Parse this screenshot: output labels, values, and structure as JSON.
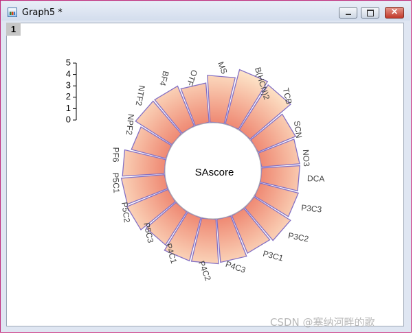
{
  "window": {
    "title": "Graph5 *",
    "layer_label": "1",
    "close_glyph": "✕"
  },
  "watermark": "CSDN @塞纳河畔的歌",
  "chart_data": {
    "type": "radial-bar",
    "center_label": "SAscore",
    "categories": [
      "DCA",
      "P3C3",
      "P3C2",
      "P3C1",
      "P4C3",
      "P4C2",
      "P4C1",
      "P5C3",
      "P5C2",
      "P5C1",
      "PF6",
      "NPF2",
      "NTF2",
      "BF4",
      "OTF",
      "MS",
      "B(HCN)2",
      "TCB",
      "SCN",
      "NO3"
    ],
    "values": [
      3.0,
      3.1,
      3.4,
      3.2,
      3.4,
      3.5,
      3.5,
      3.1,
      3.5,
      3.4,
      3.3,
      2.8,
      3.4,
      3.4,
      3.1,
      3.7,
      4.4,
      4.2,
      3.2,
      3.0
    ],
    "radial_axis": {
      "ticks": [
        "0",
        "1",
        "2",
        "3",
        "4",
        "5"
      ],
      "range": [
        0,
        5
      ]
    },
    "colors": {
      "inner": "#ef8a74",
      "outer": "#fff3d6",
      "edge": "#8470c4",
      "hub_edge": "#b2b2b2"
    },
    "legend": "none",
    "grid": false
  }
}
